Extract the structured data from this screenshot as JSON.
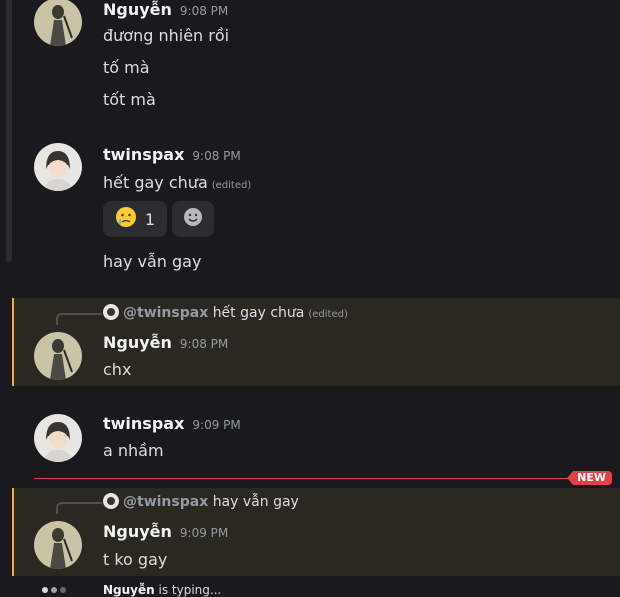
{
  "messages": [
    {
      "author": "Nguyễn",
      "time": "9:08 PM",
      "lines": [
        "đương nhiên rồi",
        "tố mà",
        "tốt mà"
      ]
    },
    {
      "author": "twinspax",
      "time": "9:08 PM",
      "line1": "hết gay chưa",
      "edited": "(edited)",
      "reaction_count": "1",
      "line2": "hay vẫn gay"
    },
    {
      "reply_to": "@twinspax",
      "reply_text": "hết gay chưa",
      "reply_edited": "(edited)",
      "author": "Nguyễn",
      "time": "9:08 PM",
      "text": "chx"
    },
    {
      "author": "twinspax",
      "time": "9:09 PM",
      "text": "a nhầm"
    },
    {
      "reply_to": "@twinspax",
      "reply_text": "hay vẫn gay",
      "author": "Nguyễn",
      "time": "9:09 PM",
      "text": "t ko gay"
    }
  ],
  "new_badge": "NEW",
  "typing": {
    "user": "Nguyễn",
    "suffix": "is typing..."
  },
  "colors": {
    "accent_highlight": "#f0b232",
    "new_red": "#e04347",
    "background": "#1a1a1e"
  },
  "icons": [
    "crying-emoji-icon",
    "add-reaction-icon",
    "reply-avatar-icon",
    "typing-indicator-icon"
  ]
}
